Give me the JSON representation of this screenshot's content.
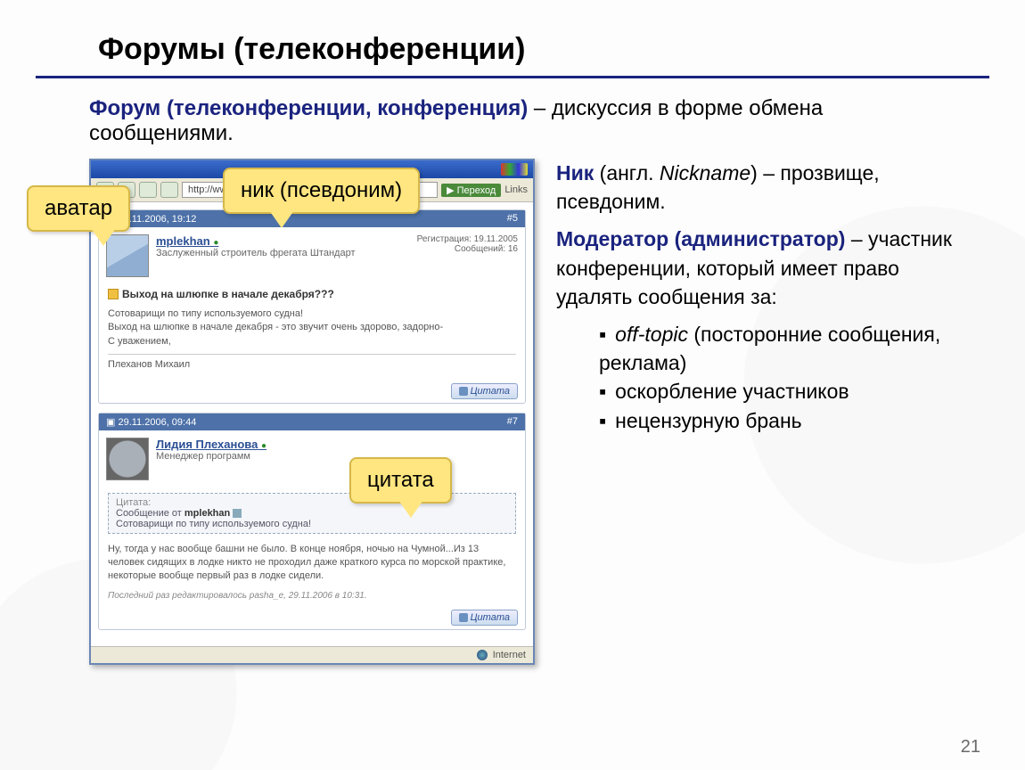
{
  "title": "Форумы (телеконференции)",
  "intro_bold": "Форум (телеконференции, конференция)",
  "intro_rest": " – дискуссия в форме обмена сообщениями.",
  "callouts": {
    "avatar": "аватар",
    "nick": "ник (псевдоним)",
    "quote": "цитата"
  },
  "window": {
    "address": "http://www.shtandart.ru/forum                    t=436",
    "go": "Переход",
    "links": "Links",
    "status": "Internet"
  },
  "post1": {
    "date": "29.11.2006, 19:12",
    "num": "#5",
    "username": "mplekhan",
    "online": "●",
    "rank": "Заслуженный строитель фрегата Штандарт",
    "reg": "Регистрация: 19.11.2005",
    "msgs": "Сообщений: 16",
    "subject": "Выход на шлюпке в начале декабря???",
    "body1": "Сотоварищи по типу используемого судна!",
    "body2": "Выход на шлюпке в начале декабря - это звучит очень здорово, задорно-",
    "body3": "С уважением,",
    "sig": "Плеханов Михаил",
    "quote_btn": "Цитата"
  },
  "post2": {
    "date": "29.11.2006, 09:44",
    "num": "#7",
    "username": "Лидия Плеханова",
    "online": "●",
    "rank": "Менеджер программ",
    "qlabel": "Цитата:",
    "qfrom_prefix": "Сообщение от ",
    "qfrom_user": "mplekhan",
    "qtext": "Сотоварищи по типу используемого судна!",
    "body1": "Ну, тогда у нас вообще башни не было. В конце ноября, ночью на Чумной...Из 13 человек сидящих в лодке никто не проходил даже краткого курса по морской практике, некоторые вообще первый раз в лодке сидели.",
    "edited": "Последний раз редактировалось pasha_e, 29.11.2006 в 10:31.",
    "quote_btn": "Цитата"
  },
  "right": {
    "nick_term": "Ник",
    "nick_paren": " (англ. ",
    "nick_eng": "Nickname",
    "nick_rest": ") – прозвище, псевдоним.",
    "mod_term": "Модератор (администратор)",
    "mod_rest": " – участник конференции, который имеет право удалять сообщения за:",
    "li1_em": "off-topic",
    "li1_rest": " (посторонние сообщения, реклама)",
    "li2": "оскорбление участников",
    "li3": "нецензурную брань"
  },
  "pagenum": "21"
}
